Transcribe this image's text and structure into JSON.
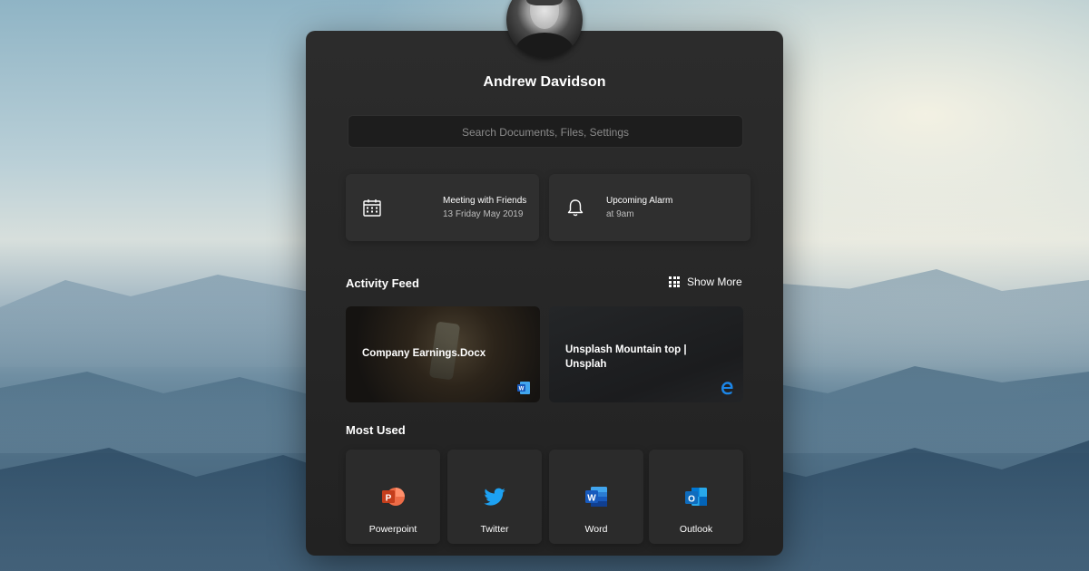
{
  "user": {
    "name": "Andrew Davidson"
  },
  "search": {
    "placeholder": "Search Documents, Files, Settings"
  },
  "cards": [
    {
      "icon": "calendar-icon",
      "title": "Meeting with Friends",
      "subtitle": "13 Friday May 2019"
    },
    {
      "icon": "bell-icon",
      "title": "Upcoming Alarm",
      "subtitle": "at 9am"
    }
  ],
  "activity_feed": {
    "title": "Activity Feed",
    "show_more": "Show More",
    "items": [
      {
        "title": "Company Earnings.Docx",
        "app_icon": "word-icon"
      },
      {
        "title": "Unsplash Mountain top | Unsplah",
        "app_icon": "edge-icon"
      }
    ]
  },
  "most_used": {
    "title": "Most Used",
    "apps": [
      {
        "label": "Powerpoint",
        "icon": "powerpoint-icon",
        "color": "#D24726"
      },
      {
        "label": "Twitter",
        "icon": "twitter-icon",
        "color": "#1DA1F2"
      },
      {
        "label": "Word",
        "icon": "word-icon",
        "color": "#2B579A"
      },
      {
        "label": "Outlook",
        "icon": "outlook-icon",
        "color": "#0072C6"
      }
    ]
  }
}
